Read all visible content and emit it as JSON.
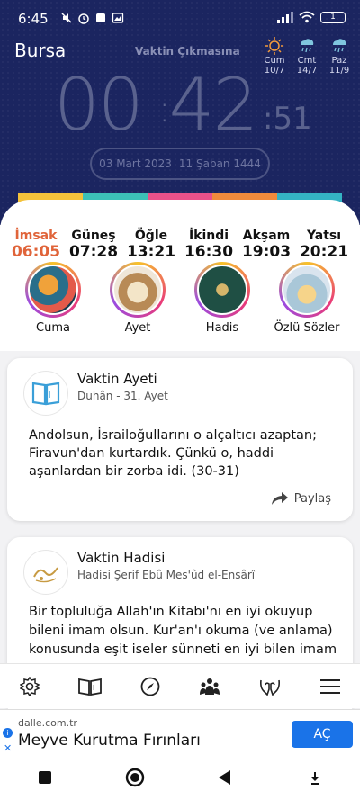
{
  "status_bar": {
    "time": "6:45",
    "battery": "1",
    "icons": [
      "mute-icon",
      "alarm-icon",
      "notification-icon",
      "image-icon"
    ]
  },
  "header": {
    "city": "Bursa",
    "remaining_label": "Vaktin Çıkmasına",
    "countdown": {
      "hours": "00",
      "minutes": "42",
      "seconds": "51"
    },
    "date_gregorian": "03 Mart 2023",
    "date_hijri": "11 Şaban 1444",
    "weather": [
      {
        "day": "Cum",
        "temp": "10/7",
        "icon": "sun-icon"
      },
      {
        "day": "Cmt",
        "temp": "14/7",
        "icon": "rain-icon"
      },
      {
        "day": "Paz",
        "temp": "11/9",
        "icon": "rain-icon"
      }
    ]
  },
  "prayers": [
    {
      "name": "İmsak",
      "time": "06:05",
      "active": true
    },
    {
      "name": "Güneş",
      "time": "07:28",
      "active": false
    },
    {
      "name": "Öğle",
      "time": "13:21",
      "active": false
    },
    {
      "name": "İkindi",
      "time": "16:30",
      "active": false
    },
    {
      "name": "Akşam",
      "time": "19:03",
      "active": false
    },
    {
      "name": "Yatsı",
      "time": "20:21",
      "active": false
    }
  ],
  "stories": [
    {
      "label": "Cuma"
    },
    {
      "label": "Ayet"
    },
    {
      "label": "Hadis"
    },
    {
      "label": "Özlü Sözler"
    }
  ],
  "verse_card": {
    "title": "Vaktin Ayeti",
    "subtitle": "Duhân - 31. Ayet",
    "text": "Andolsun, İsrailoğullarını o alçaltıcı azaptan; Firavun'dan kurtardık. Çünkü o, haddi aşanlardan bir zorba idi. (30-31)",
    "share_label": "Paylaş"
  },
  "hadith_card": {
    "title": "Vaktin Hadisi",
    "subtitle": "Hadisi Şerif  Ebû Mes'ûd el-Ensârî",
    "text": "Bir topluluğa Allah'ın Kitabı'nı en iyi okuyup bileni imam olsun. Kur'an'ı okuma (ve anlama) konusunda eşit iseler sünneti en iyi bilen imam olsun. Bir kimse, izin"
  },
  "tabs": [
    "settings-icon",
    "quran-icon",
    "compass-icon",
    "community-icon",
    "prayer-hands-icon",
    "menu-icon"
  ],
  "ad": {
    "domain": "dalle.com.tr",
    "title": "Meyve Kurutma Fırınları",
    "button": "AÇ"
  },
  "colors": {
    "header_bg": "#1b2560",
    "active": "#e0643a",
    "ad_button": "#1a73e8"
  }
}
